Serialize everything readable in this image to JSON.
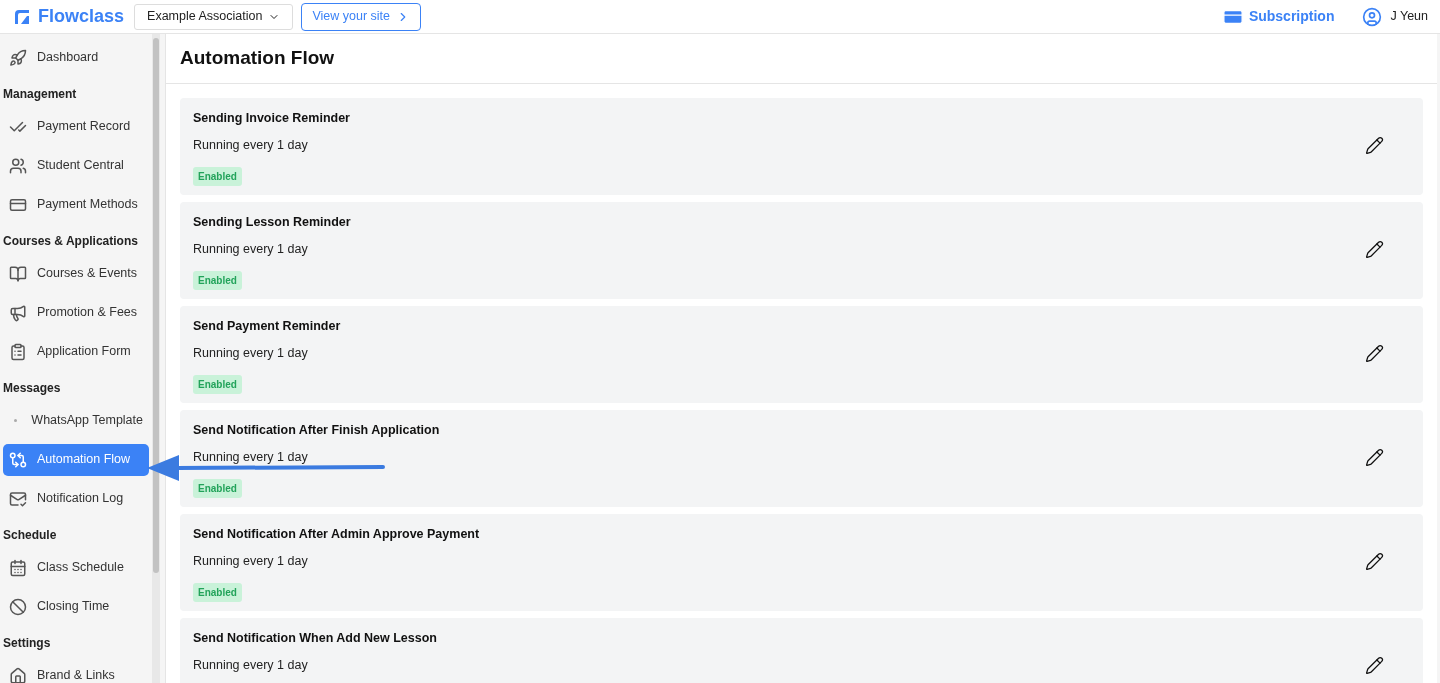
{
  "header": {
    "brand": "Flowclass",
    "organization": "Example Association",
    "view_site": "View your site",
    "subscription": "Subscription",
    "user": "J Yeun"
  },
  "sidebar": {
    "sections": [
      {
        "items": [
          {
            "label": "Dashboard",
            "selected": false
          }
        ]
      },
      {
        "heading": "Management",
        "items": [
          {
            "label": "Payment Record",
            "selected": false
          },
          {
            "label": "Student Central",
            "selected": false
          },
          {
            "label": "Payment Methods",
            "selected": false
          }
        ]
      },
      {
        "heading": "Courses & Applications",
        "items": [
          {
            "label": "Courses & Events",
            "selected": false
          },
          {
            "label": "Promotion & Fees",
            "selected": false
          },
          {
            "label": "Application Form",
            "selected": false
          }
        ]
      },
      {
        "heading": "Messages",
        "items": [
          {
            "label": "WhatsApp Template",
            "selected": false
          },
          {
            "label": "Automation Flow",
            "selected": true
          },
          {
            "label": "Notification Log",
            "selected": false
          }
        ]
      },
      {
        "heading": "Schedule",
        "items": [
          {
            "label": "Class Schedule",
            "selected": false
          },
          {
            "label": "Closing Time",
            "selected": false
          }
        ]
      },
      {
        "heading": "Settings",
        "items": [
          {
            "label": "Brand & Links",
            "selected": false
          }
        ]
      }
    ]
  },
  "page": {
    "title": "Automation Flow"
  },
  "flows": [
    {
      "name": "Sending Invoice Reminder",
      "schedule": "Running every 1 day",
      "status": "Enabled"
    },
    {
      "name": "Sending Lesson Reminder",
      "schedule": "Running every 1 day",
      "status": "Enabled"
    },
    {
      "name": "Send Payment Reminder",
      "schedule": "Running every 1 day",
      "status": "Enabled"
    },
    {
      "name": "Send Notification After Finish Application",
      "schedule": "Running every 1 day",
      "status": "Enabled"
    },
    {
      "name": "Send Notification After Admin Approve Payment",
      "schedule": "Running every 1 day",
      "status": "Enabled"
    },
    {
      "name": "Send Notification When Add New Lesson",
      "schedule": "Running every 1 day"
    }
  ]
}
